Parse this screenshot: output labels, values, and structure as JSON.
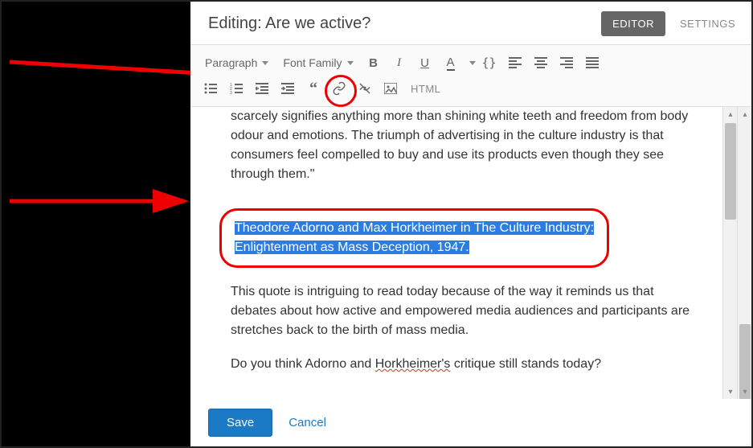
{
  "header": {
    "title": "Editing: Are we active?",
    "editor_btn": "EDITOR",
    "settings_btn": "SETTINGS"
  },
  "toolbar": {
    "paragraph": "Paragraph",
    "font_family": "Font Family",
    "html": "HTML"
  },
  "content": {
    "p1": "scarcely signifies anything more than shining white teeth and freedom from body odour and emotions. The triumph of advertising in the culture industry is that consumers feel compelled to buy and use its products even though they see through them.\"",
    "citation_l1": "Theodore Adorno and Max Horkheimer in The Culture Industry:",
    "citation_l2": "Enlightenment as Mass Deception, 1947.",
    "p3": "This quote is intriguing to read today because of the way it reminds us that debates about how active and empowered media audiences and participants are stretches back to the birth of mass media.",
    "p4_a": "Do you think Adorno and ",
    "p4_b": "Horkheimer's",
    "p4_c": " critique still stands today?"
  },
  "footer": {
    "save": "Save",
    "cancel": "Cancel"
  }
}
